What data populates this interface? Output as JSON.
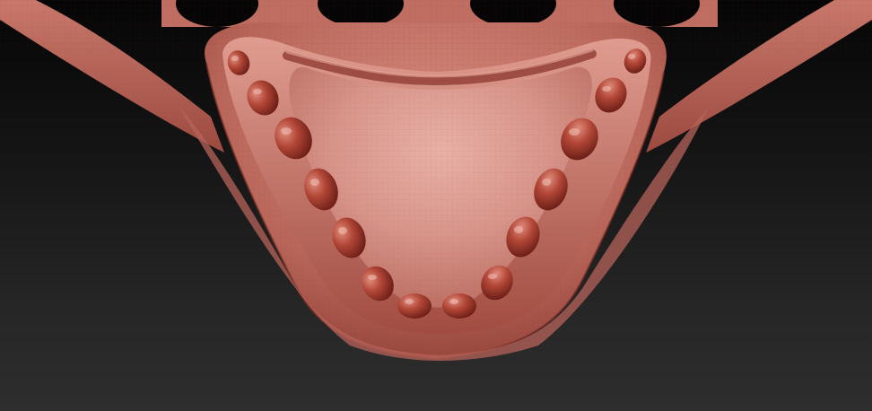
{
  "viewport": {
    "background_top": "#050505",
    "background_bottom": "#2e2e2e"
  },
  "model": {
    "name": "lower-jaw-sculpt",
    "material_color": "#b85a4e",
    "material_highlight": "#e6a59a",
    "material_shadow": "#6e2620",
    "tooth_color": "#b4483a",
    "tooth_count": 14
  }
}
